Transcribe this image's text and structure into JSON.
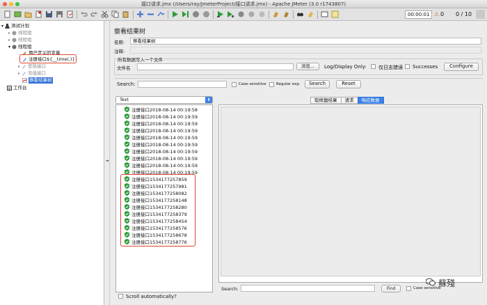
{
  "window": {
    "title": "接口请求.jmx (/Users/ray/JmeterProject/接口请求.jmx) - Apache JMeter (3.0 r1743807)"
  },
  "toolbar": {
    "timer": "00:00:01",
    "warnings": "0",
    "threads": "0 / 10"
  },
  "tree": {
    "test_plan": "测试计划",
    "thread_group_1": "线程组",
    "thread_group_2": "线程组",
    "thread_group_3": "线程组",
    "user_vars": "用户定义的变量",
    "register": "注册接口${__time(,)}",
    "login": "登陆接口",
    "recharge": "充值接口",
    "result_tree": "察看结果树",
    "workbench": "工作台"
  },
  "panel": {
    "title": "察看结果树",
    "name_label": "名称:",
    "name_value": "察看结果树",
    "comment_label": "注释:",
    "file_group": "所有数据写入一个文件",
    "file_label": "文件名",
    "browse": "浏览...",
    "log_label": "Log/Display Only:",
    "errors_label": "仅日志错误",
    "successes_label": "Successes",
    "configure": "Configure",
    "search_label": "Search:",
    "case_sensitive": "Case sensitive",
    "regular_exp": "Regular exp.",
    "search_btn": "Search",
    "reset_btn": "Reset",
    "renderer": "Text",
    "tabs": [
      "取样器结果",
      "请求",
      "响应数据"
    ],
    "bottom_search_label": "Search:",
    "find_btn": "Find",
    "bottom_case": "Case sensitive",
    "scroll_auto": "Scroll automatically?"
  },
  "results": [
    "注册接口2018-08-14 00:19:58",
    "注册接口2018-08-14 00:19:59",
    "注册接口2018-08-14 00:19:59",
    "注册接口2018-08-14 00:19:59",
    "注册接口2018-08-14 00:19:59",
    "注册接口2018-08-14 00:19:59",
    "注册接口2018-08-14 00:19:59",
    "注册接口2018-08-14 00:19:59",
    "注册接口2018-08-14 00:19:59",
    "注册接口2018-08-14 00:19:59",
    "注册接口1534177257859",
    "注册接口1534177257981",
    "注册接口1534177258082",
    "注册接口1534177258148",
    "注册接口1534177258280",
    "注册接口1534177258379",
    "注册接口1534177258454",
    "注册接口1534177258576",
    "注册接口1534177258678",
    "注册接口1534177258776"
  ],
  "watermark": {
    "text": "蘇殘"
  },
  "colors": {
    "accent": "#3b82e6",
    "highlight": "#e0452f",
    "success": "#2e9b3a"
  }
}
